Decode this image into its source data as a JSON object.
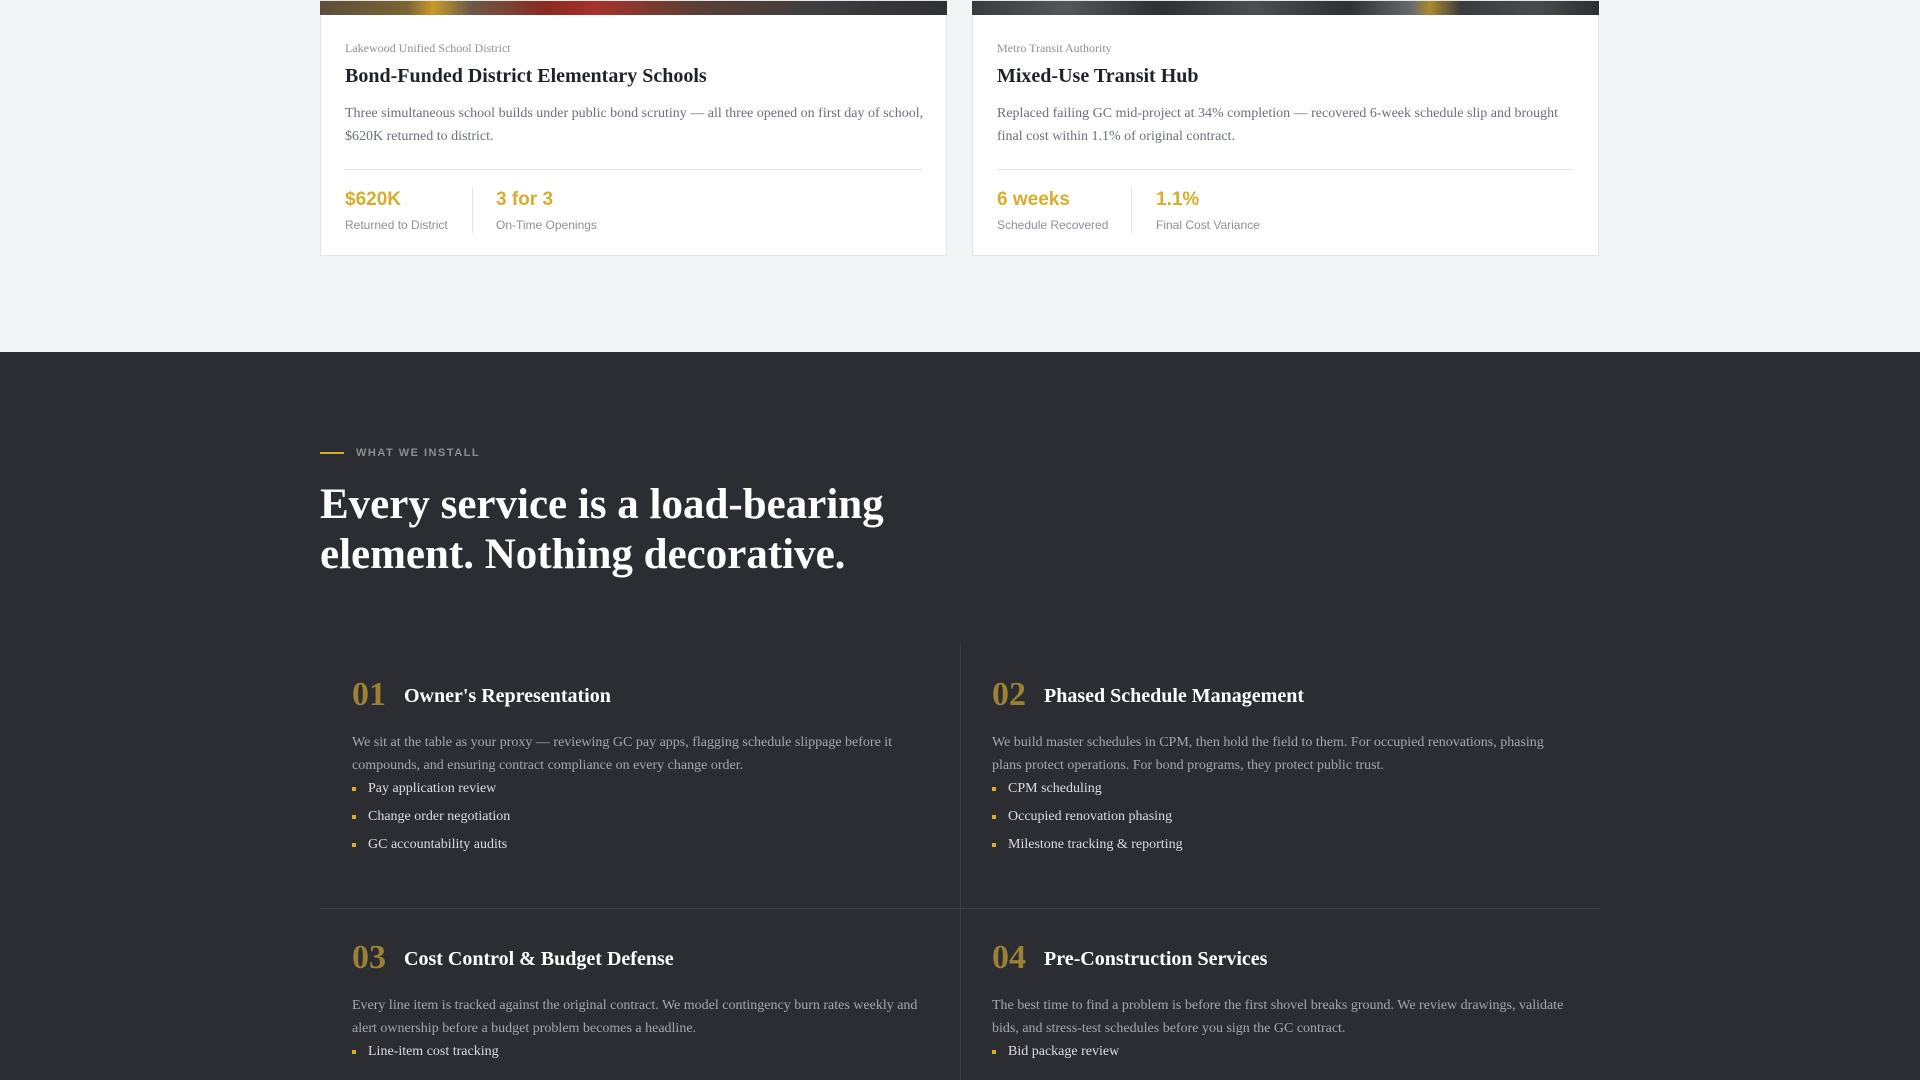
{
  "cases": [
    {
      "client": "Lakewood Unified School District",
      "title": "Bond-Funded District Elementary Schools",
      "description": "Three simultaneous school builds under public bond scrutiny — all three opened on first day of school, $620K returned to district.",
      "stats": [
        {
          "value": "$620K",
          "label": "Returned to District"
        },
        {
          "value": "3 for 3",
          "label": "On-Time Openings"
        }
      ]
    },
    {
      "client": "Metro Transit Authority",
      "title": "Mixed-Use Transit Hub",
      "description": "Replaced failing GC mid-project at 34% completion — recovered 6-week schedule slip and brought final cost within 1.1% of original contract.",
      "stats": [
        {
          "value": "6 weeks",
          "label": "Schedule Recovered"
        },
        {
          "value": "1.1%",
          "label": "Final Cost Variance"
        }
      ]
    }
  ],
  "services": {
    "eyebrow": "WHAT WE INSTALL",
    "headline": "Every service is a load-bearing element. Nothing decorative.",
    "items": [
      {
        "number": "01",
        "title": "Owner's Representation",
        "description": "We sit at the table as your proxy — reviewing GC pay apps, flagging schedule slippage before it compounds, and ensuring contract compliance on every change order.",
        "bullets": [
          "Pay application review",
          "Change order negotiation",
          "GC accountability audits"
        ]
      },
      {
        "number": "02",
        "title": "Phased Schedule Management",
        "description": "We build master schedules in CPM, then hold the field to them. For occupied renovations, phasing plans protect operations. For bond programs, they protect public trust.",
        "bullets": [
          "CPM scheduling",
          "Occupied renovation phasing",
          "Milestone tracking & reporting"
        ]
      },
      {
        "number": "03",
        "title": "Cost Control & Budget Defense",
        "description": "Every line item is tracked against the original contract. We model contingency burn rates weekly and alert ownership before a budget problem becomes a headline.",
        "bullets": [
          "Line-item cost tracking"
        ]
      },
      {
        "number": "04",
        "title": "Pre-Construction Services",
        "description": "The best time to find a problem is before the first shovel breaks ground. We review drawings, validate bids, and stress-test schedules before you sign the GC contract.",
        "bullets": [
          "Bid package review"
        ]
      }
    ]
  },
  "colors": {
    "accent": "#d7ad2b",
    "number_gold": "#9c8135",
    "dark_bg": "#2b2d33",
    "light_bg": "#f3f4f6"
  }
}
